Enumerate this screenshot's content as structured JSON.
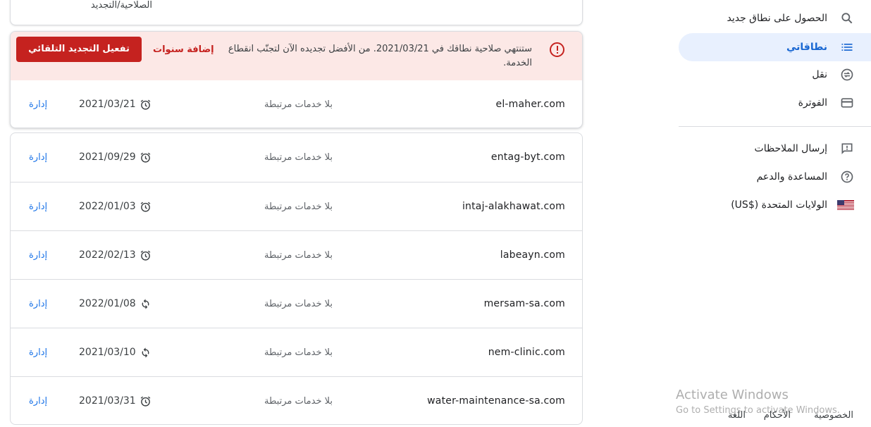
{
  "top_card": {
    "header_label": "الصلاحية/التجديد"
  },
  "alert": {
    "message": "ستنتهي صلاحية نطاقك في 2021/03/21. من الأفضل تجديده الآن لتجنّب انقطاع الخدمة.",
    "add_years_label": "إضافة سنوات",
    "auto_renew_label": "تفعيل التجديد التلقائي",
    "accent_color": "#c5221f"
  },
  "alert_domain": {
    "name": "el-maher.com",
    "services": "بلا خدمات مرتبطة",
    "status_icon": "alarm-icon",
    "date": "2021/03/21",
    "manage_label": "إدارة"
  },
  "domains": [
    {
      "name": "entag-byt.com",
      "services": "بلا خدمات مرتبطة",
      "status_icon": "alarm-icon",
      "date": "2021/09/29",
      "manage_label": "إدارة"
    },
    {
      "name": "intaj-alakhawat.com",
      "services": "بلا خدمات مرتبطة",
      "status_icon": "alarm-icon",
      "date": "2022/01/03",
      "manage_label": "إدارة"
    },
    {
      "name": "labeayn.com",
      "services": "بلا خدمات مرتبطة",
      "status_icon": "alarm-icon",
      "date": "2022/02/13",
      "manage_label": "إدارة"
    },
    {
      "name": "mersam-sa.com",
      "services": "بلا خدمات مرتبطة",
      "status_icon": "autorenew-icon",
      "date": "2022/01/08",
      "manage_label": "إدارة"
    },
    {
      "name": "nem-clinic.com",
      "services": "بلا خدمات مرتبطة",
      "status_icon": "autorenew-icon",
      "date": "2021/03/10",
      "manage_label": "إدارة"
    },
    {
      "name": "water-maintenance-sa.com",
      "services": "بلا خدمات مرتبطة",
      "status_icon": "alarm-icon",
      "date": "2021/03/31",
      "manage_label": "إدارة"
    }
  ],
  "sidebar": {
    "items": [
      {
        "label": "الحصول على نطاق جديد",
        "icon": "search-icon"
      },
      {
        "label": "نطاقاتي",
        "icon": "list-icon",
        "active": true
      },
      {
        "label": "نقل",
        "icon": "transfer-icon"
      },
      {
        "label": "الفوترة",
        "icon": "credit-card-icon"
      }
    ],
    "secondary_items": [
      {
        "label": "إرسال الملاحظات",
        "icon": "feedback-icon"
      },
      {
        "label": "المساعدة والدعم",
        "icon": "help-icon"
      },
      {
        "label": "الولايات المتحدة ($US)",
        "icon": "us-flag-icon"
      }
    ]
  },
  "footer": {
    "privacy": "الخصوصية",
    "terms": "الأحكام",
    "language": "اللغة"
  },
  "watermark": {
    "title": "Activate Windows",
    "subtitle": "Go to Settings to activate Windows."
  },
  "colors": {
    "link": "#1a73e8",
    "active_nav_bg": "#e8f0fe",
    "active_nav_text": "#1967d2"
  }
}
